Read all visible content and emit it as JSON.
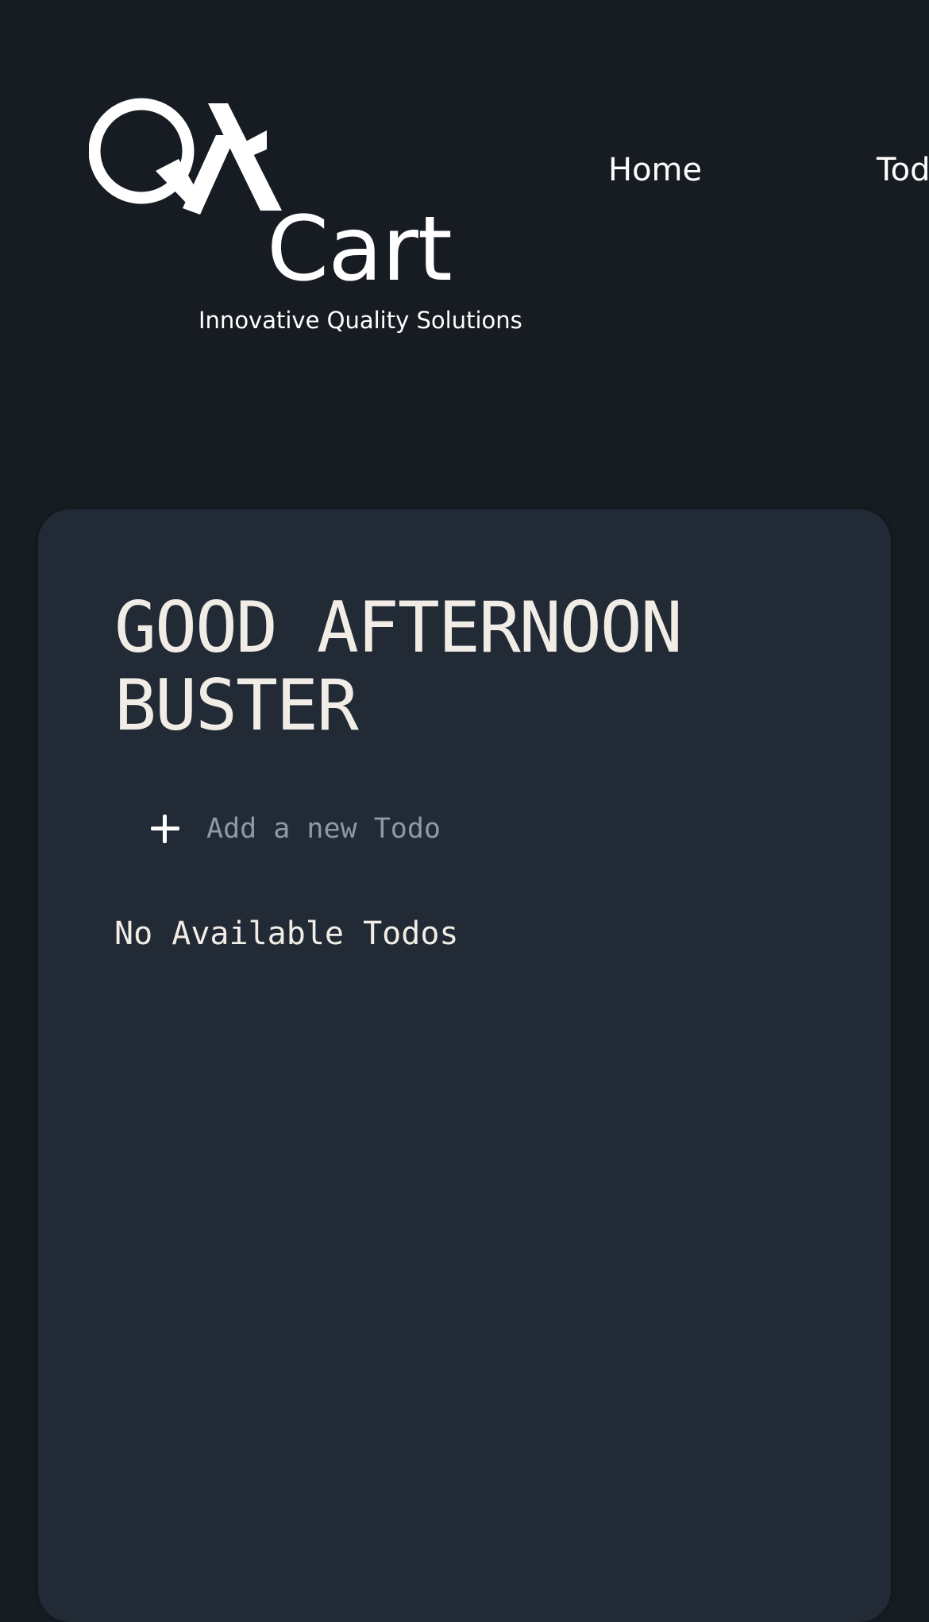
{
  "logo": {
    "wordmark": "Cart",
    "tagline": "Innovative Quality Solutions"
  },
  "nav": {
    "home": "Home",
    "todos": "Todos"
  },
  "card": {
    "greeting": "GOOD AFTERNOON BUSTER",
    "add_todo": {
      "placeholder": "Add a new Todo",
      "value": ""
    },
    "empty_message": "No Available Todos"
  },
  "colors": {
    "page_background": "#171c23",
    "card_background": "#212a35",
    "text_primary": "#f1ede6",
    "placeholder_text": "#8f99a5"
  },
  "icons": {
    "add": "plus-icon",
    "logo_mark": "qa-check-logo-icon"
  }
}
